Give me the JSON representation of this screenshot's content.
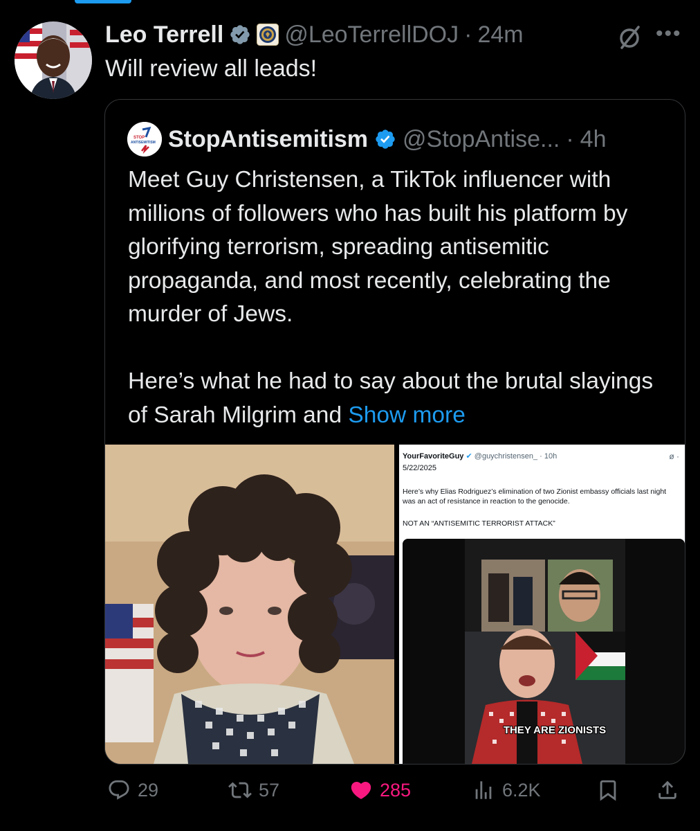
{
  "tweet": {
    "author_name": "Leo Terrell",
    "handle": "@LeoTerrellDOJ",
    "separator": "·",
    "time": "24m",
    "text": "Will review all leads!",
    "more_icon": "more-dots-icon",
    "grok_icon": "grok-icon"
  },
  "quote": {
    "author_name": "StopAntisemitism",
    "handle": "@StopAntise...",
    "separator": "·",
    "time": "4h",
    "logo_text_top": "STOP",
    "logo_text_bottom": "ANTISEMITISM",
    "text": "Meet Guy Christensen, a TikTok influencer with millions of followers who has built his platform by glorifying terrorism, spreading antisemitic propaganda, and most recently, celebrating the murder of Jews.\n\nHere’s what he had to say about the brutal slayings of Sarah Milgrim and ",
    "show_more": "Show more"
  },
  "embedded_screenshot": {
    "name": "YourFavoriteGuy",
    "handle": "@guychristensen_",
    "separator": "·",
    "time": "10h",
    "date": "5/22/2025",
    "body": "Here’s why Elias Rodriguez’s elimination of two Zionist embassy officials last night was an act of resistance in reaction to the genocide.",
    "caps": "NOT AN “ANTISEMITIC TERRORIST ATTACK”",
    "caption": "THEY ARE ZIONISTS"
  },
  "actions": {
    "replies": "29",
    "reposts": "57",
    "likes": "285",
    "views": "6.2K"
  },
  "colors": {
    "accent": "#1d9bf0",
    "like": "#f91880",
    "muted": "#71767b",
    "text": "#e7e9ea",
    "background": "#000000"
  }
}
